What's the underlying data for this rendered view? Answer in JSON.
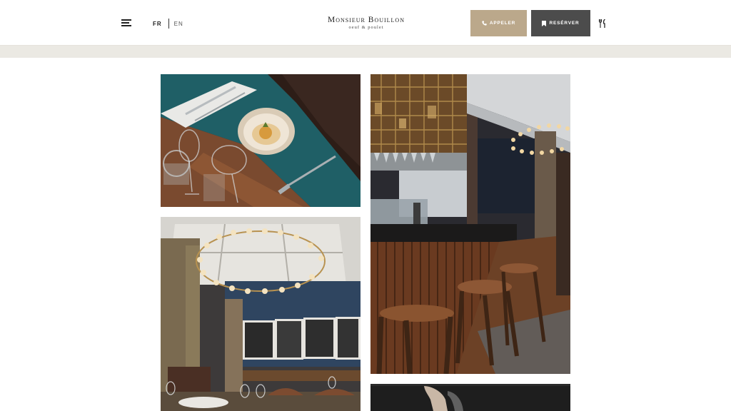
{
  "header": {
    "menu_icon": "hamburger-menu-icon",
    "languages": {
      "active": "FR",
      "other": "EN"
    },
    "logo": {
      "name": "Monsieur Bouillon",
      "tagline": "oeuf & poulet"
    },
    "call_button": {
      "label": "APPELER",
      "icon": "phone-icon",
      "color": "#bba88b"
    },
    "book_button": {
      "label": "RESÉRVER",
      "icon": "bookmark-icon",
      "color": "#4c4c4c"
    },
    "menu_link_icon": "fork-knife-icon"
  },
  "gallery": {
    "images": [
      {
        "subject": "table-setting-dish"
      },
      {
        "subject": "bar-counter-stools"
      },
      {
        "subject": "dining-room-chandelier"
      },
      {
        "subject": "hand-dark"
      }
    ]
  },
  "colors": {
    "accent": "#bba88b",
    "dark_button": "#4c4c4c",
    "band": "#ebe9e3"
  }
}
